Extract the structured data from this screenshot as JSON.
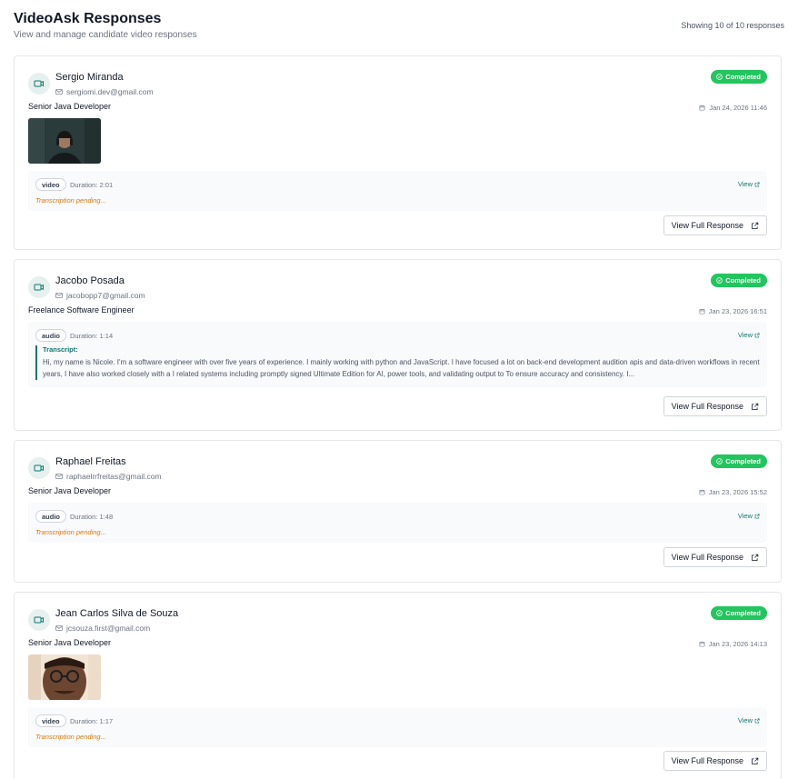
{
  "header": {
    "title": "VideoAsk Responses",
    "subtitle": "View and manage candidate video responses",
    "showing": "Showing 10 of 10 responses"
  },
  "colors": {
    "accent": "#0f766e",
    "completed": "#22c55e",
    "pending": "#d97706"
  },
  "icons": [
    "video-icon",
    "mail-icon",
    "calendar-icon",
    "check-circle-icon",
    "external-link-icon"
  ],
  "cards": [
    {
      "name": "Sergio Miranda",
      "email": "sergiomi.dev@gmail.com",
      "role": "Senior Java Developer",
      "status": "Completed",
      "date": "Jan 24, 2026 11:46",
      "media_type": "video",
      "duration": "Duration: 2:01",
      "view_label": "View",
      "transcription": "Transcription pending...",
      "button": "View Full Response"
    },
    {
      "name": "Jacobo Posada",
      "email": "jacobopp7@gmail.com",
      "role": "Freelance Software Engineer",
      "status": "Completed",
      "date": "Jan 23, 2026 16:51",
      "media_type": "audio",
      "duration": "Duration: 1:14",
      "view_label": "View",
      "transcript_label": "Transcript:",
      "transcript": "Hi, my name is Nicole. I'm a software engineer with over five years of experience. I mainly working with python and JavaScript. I have focused a lot on back-end development audition apis and data-driven workflows in recent years, I have also worked closely with a I related systems including promptly signed Ultimate Edition for AI, power tools, and validating output to To ensure accuracy and consistency. I...",
      "button": "View Full Response"
    },
    {
      "name": "Raphael Freitas",
      "email": "raphaelrrfreitas@gmail.com",
      "role": "Senior Java Developer",
      "status": "Completed",
      "date": "Jan 23, 2026 15:52",
      "media_type": "audio",
      "duration": "Duration: 1:48",
      "view_label": "View",
      "transcription": "Transcription pending...",
      "button": "View Full Response"
    },
    {
      "name": "Jean Carlos Silva de Souza",
      "email": "jcsouza.first@gmail.com",
      "role": "Senior Java Developer",
      "status": "Completed",
      "date": "Jan 23, 2026 14:13",
      "media_type": "video",
      "duration": "Duration: 1:17",
      "view_label": "View",
      "transcription": "Transcription pending...",
      "button": "View Full Response"
    }
  ]
}
